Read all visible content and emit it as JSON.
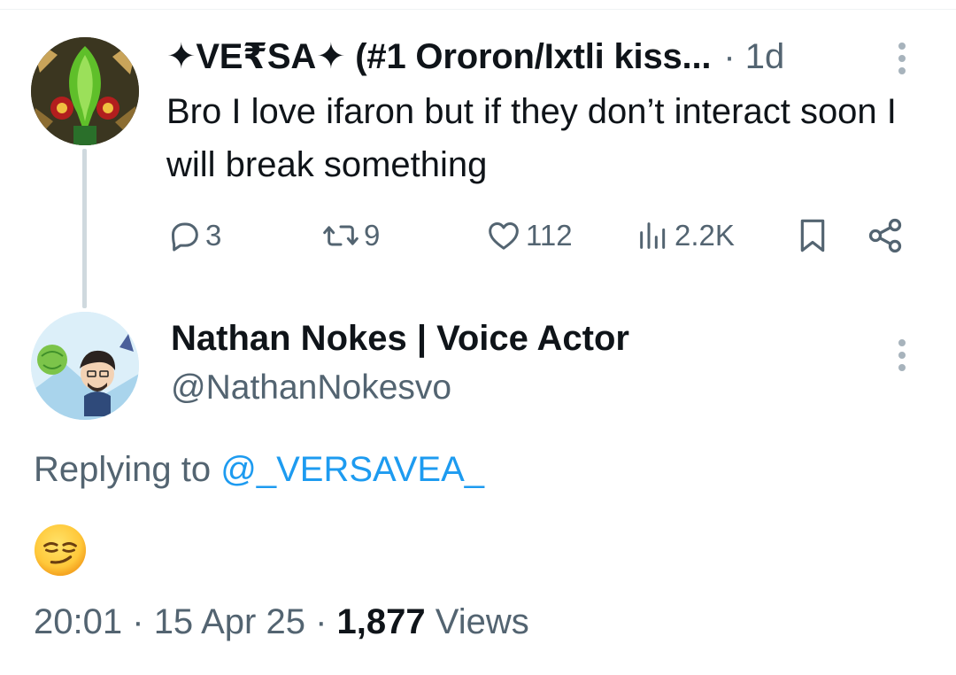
{
  "parent_tweet": {
    "display_name": "✦VE₹SA✦ (#1 Ororon/Ixtli kiss...",
    "separator": "·",
    "time": "1d",
    "text": "Bro I love ifaron but if they don’t interact soon I will break something",
    "stats": {
      "replies": "3",
      "reposts": "9",
      "likes": "112",
      "views": "2.2K"
    }
  },
  "reply_tweet": {
    "display_name": "Nathan Nokes | Voice Actor",
    "handle": "@NathanNokesvo",
    "replying_prefix": "Replying to",
    "replying_to": "@_VERSAVEA_",
    "emoji": "smirking-face",
    "time": "20:01",
    "date": "15 Apr 25",
    "views_count": "1,877",
    "views_label": "Views",
    "separator": "·"
  },
  "colors": {
    "text_primary": "#0f1419",
    "text_secondary": "#536471",
    "link": "#1d9bf0",
    "thread_line": "#cfd9de"
  }
}
